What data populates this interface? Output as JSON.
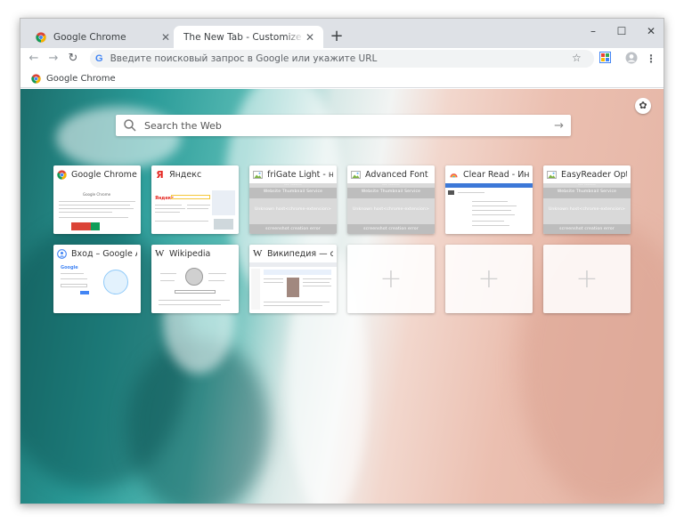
{
  "tabs": [
    {
      "title": "Google Chrome",
      "active": false,
      "icon": "chrome-icon"
    },
    {
      "title": "The New Tab - Customize Your Start Page",
      "active": true,
      "icon": "none"
    }
  ],
  "address_bar": {
    "placeholder": "Введите поисковый запрос в Google или укажите URL"
  },
  "bookmarks": [
    {
      "label": "Google Chrome",
      "icon": "chrome-icon"
    }
  ],
  "search": {
    "placeholder": "Search the Web"
  },
  "tiles": [
    {
      "label": "Google Chrome",
      "icon": "chrome-icon"
    },
    {
      "label": "Яндекс",
      "icon": "yandex-icon"
    },
    {
      "label": "friGate Light - наст...",
      "icon": "broken-image-icon"
    },
    {
      "label": "Advanced Font Sett...",
      "icon": "broken-image-icon"
    },
    {
      "label": "Clear Read - Интер...",
      "icon": "clear-read-icon"
    },
    {
      "label": "EasyReader Options",
      "icon": "broken-image-icon"
    },
    {
      "label": "Вход – Google Акк...",
      "icon": "google-account-icon"
    },
    {
      "label": "Wikipedia",
      "icon": "wikipedia-icon"
    },
    {
      "label": "Википедия — своб...",
      "icon": "wikipedia-icon"
    }
  ],
  "thumbnail_error": {
    "url_line": "--- -------",
    "service_line": "Website Thumbnail Service",
    "unknown_line": "Unknown host<chrome-extension>",
    "footer_line": "screenshot creation error"
  },
  "empty_tile_symbol": "+",
  "mini_pages": {
    "google_title": "Google Chrome",
    "yandex_word": "Яндекс",
    "google_word": "Google"
  },
  "colors": {
    "tabstrip": "#dee1e6",
    "ocean": "#2a9b98",
    "sand": "#ebbfb0",
    "google_blue": "#4285f4"
  }
}
